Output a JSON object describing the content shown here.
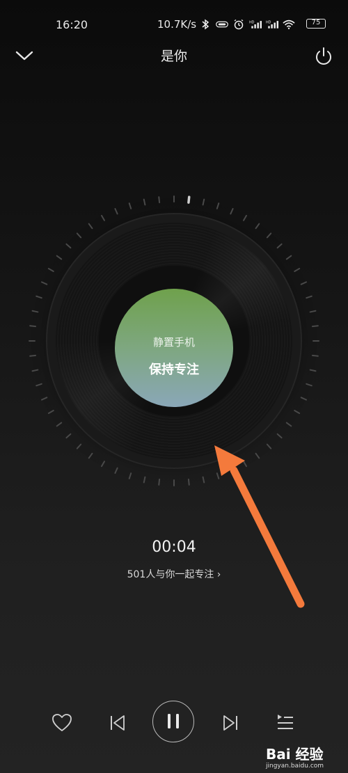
{
  "status_bar": {
    "time": "16:20",
    "network_speed": "10.7K/s",
    "battery_level": "75",
    "icons": [
      "bluetooth-icon",
      "vpn-pill-icon",
      "alarm-icon",
      "signal-hd-1-icon",
      "signal-hd-2-icon",
      "wifi-icon"
    ]
  },
  "header": {
    "title": "是你",
    "back_icon": "chevron-down-icon",
    "power_icon": "power-icon"
  },
  "disc": {
    "line1": "静置手机",
    "line2": "保持专注"
  },
  "timer": "00:04",
  "together_text": "501人与你一起专注 ›",
  "controls": {
    "like_icon": "heart-icon",
    "prev_icon": "previous-icon",
    "play_pause_icon": "pause-icon",
    "next_icon": "next-icon",
    "playlist_icon": "playlist-icon"
  },
  "watermark": {
    "main": "Bai 经验",
    "sub": "jingyan.baidu.com"
  },
  "colors": {
    "arrow": "#f47a3c",
    "label_top": "#6fa14c",
    "label_bottom": "#8aa7b8"
  }
}
